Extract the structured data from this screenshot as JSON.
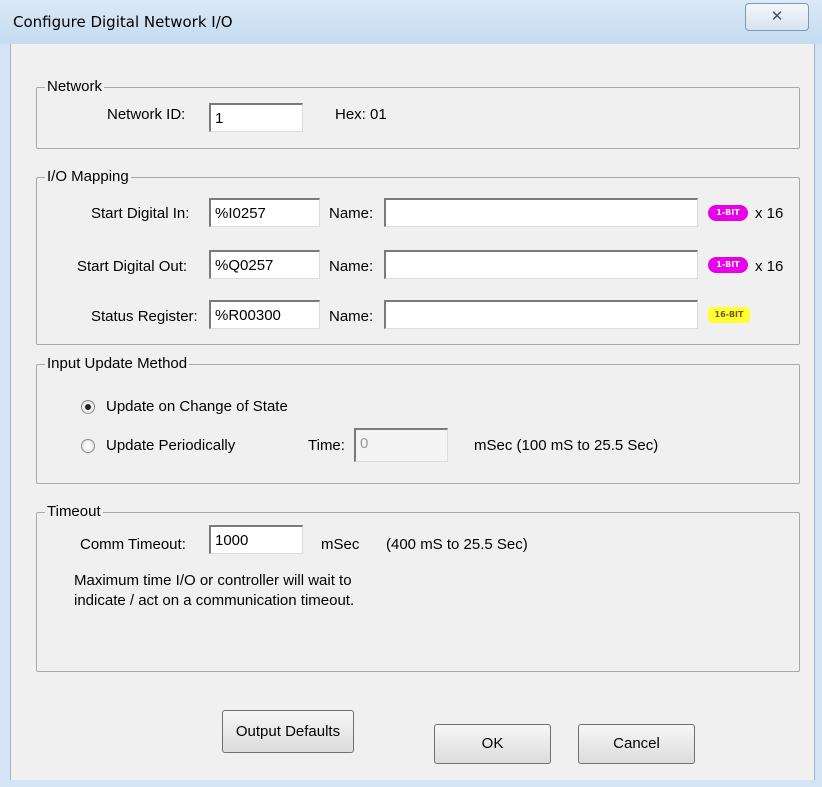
{
  "window": {
    "title": "Configure Digital Network I/O",
    "close_glyph": "✕"
  },
  "network": {
    "group_label": "Network",
    "id_label": "Network ID:",
    "id_value": "1",
    "hex_text": "Hex: 01"
  },
  "io_mapping": {
    "group_label": "I/O Mapping",
    "rows": [
      {
        "label": "Start Digital In:",
        "address": "%I0257",
        "name_label": "Name:",
        "name_value": "",
        "badge": "1-BIT",
        "badge_color": "#e800e8",
        "multiplier": "x 16"
      },
      {
        "label": "Start Digital Out:",
        "address": "%Q0257",
        "name_label": "Name:",
        "name_value": "",
        "badge": "1-BIT",
        "badge_color": "#e800e8",
        "multiplier": "x 16"
      },
      {
        "label": "Status Register:",
        "address": "%R00300",
        "name_label": "Name:",
        "name_value": "",
        "badge": "16-BIT",
        "badge_color": "#ffff33",
        "multiplier": ""
      }
    ]
  },
  "input_update": {
    "group_label": "Input Update Method",
    "option_change": "Update on Change of State",
    "option_periodic": "Update Periodically",
    "selected": "change",
    "time_label": "Time:",
    "time_value": "0",
    "time_hint": "mSec (100 mS to 25.5 Sec)"
  },
  "timeout": {
    "group_label": "Timeout",
    "comm_label": "Comm Timeout:",
    "comm_value": "1000",
    "unit": "mSec",
    "range_hint": "(400 mS to 25.5 Sec)",
    "description_line1": "Maximum time I/O or controller will wait to",
    "description_line2": "indicate / act on a communication timeout."
  },
  "buttons": {
    "output_defaults": "Output Defaults",
    "ok": "OK",
    "cancel": "Cancel"
  }
}
